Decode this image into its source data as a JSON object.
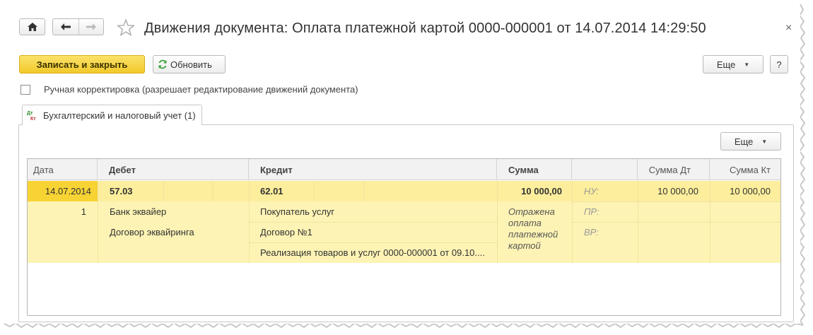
{
  "window": {
    "title": "Движения документа: Оплата платежной картой 0000-000001 от 14.07.2014 14:29:50",
    "close_icon": "close-icon"
  },
  "toolbar": {
    "save_close_label": "Записать и закрыть",
    "refresh_label": "Обновить",
    "more_label": "Еще",
    "help_label": "?"
  },
  "manual_correction": {
    "checked": false,
    "label": "Ручная корректировка (разрешает редактирование движений документа)"
  },
  "tabs": [
    {
      "label": "Бухгалтерский и налоговый учет (1)",
      "active": true,
      "icon": "dt-kt-icon"
    }
  ],
  "panel": {
    "more_label": "Еще"
  },
  "table": {
    "columns": {
      "date": "Дата",
      "debit": "Дебет",
      "credit": "Кредит",
      "sum": "Сумма",
      "blank": "",
      "sum_dt": "Сумма Дт",
      "sum_kt": "Сумма Кт"
    },
    "rows": [
      {
        "date": "14.07.2014",
        "number": "1",
        "debit_account": "57.03",
        "debit_sub1": "Банк эквайер",
        "debit_sub2": "Договор эквайринга",
        "credit_account": "62.01",
        "credit_sub1": "Покупатель услуг",
        "credit_sub2": "Договор №1",
        "credit_sub3": "Реализация товаров и услуг 0000-000001 от 09.10....",
        "sum": "10 000,00",
        "content": "Отражена оплата платежной картой",
        "nu_label": "НУ:",
        "pr_label": "ПР:",
        "vr_label": "ВР:",
        "sum_dt": "10 000,00",
        "sum_kt": "10 000,00"
      }
    ]
  },
  "colors": {
    "accent_yellow": "#f7d334",
    "row_yellow": "#fdf3b4",
    "primary_button": "#f1c92a"
  }
}
